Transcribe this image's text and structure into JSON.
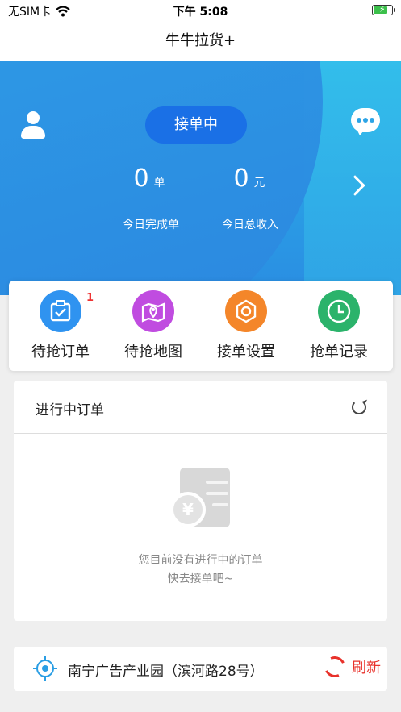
{
  "status_bar": {
    "carrier": "无SIM卡",
    "time": "下午 5:08",
    "battery_percent": 80
  },
  "nav": {
    "title": "牛牛拉货+"
  },
  "hero": {
    "status_button": "接单中",
    "completed": {
      "value": "0",
      "unit": "单",
      "label": "今日完成单"
    },
    "income": {
      "value": "0",
      "unit": "元",
      "label": "今日总收入"
    }
  },
  "quick_menu": [
    {
      "label": "待抢订单",
      "icon": "clipboard-check-icon",
      "color": "#2f93f0",
      "badge": "1"
    },
    {
      "label": "待抢地图",
      "icon": "map-pin-icon",
      "color": "#c04ce0",
      "badge": ""
    },
    {
      "label": "接单设置",
      "icon": "hex-nut-icon",
      "color": "#f4862a",
      "badge": ""
    },
    {
      "label": "抢单记录",
      "icon": "clock-icon",
      "color": "#2bb36b",
      "badge": ""
    }
  ],
  "orders": {
    "title": "进行中订单",
    "empty_line1": "您目前没有进行中的订单",
    "empty_line2": "快去接单吧~"
  },
  "location": {
    "address": "南宁广告产业园（滨河路28号）",
    "refresh_label": "刷新"
  }
}
